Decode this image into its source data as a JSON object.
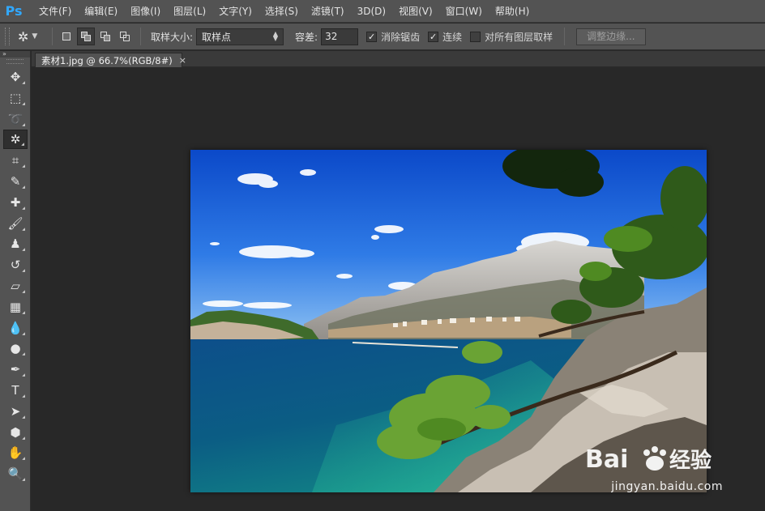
{
  "app": {
    "logo": "Ps",
    "brand_color": "#31a8ff"
  },
  "menu": [
    {
      "label": "文件(F)"
    },
    {
      "label": "编辑(E)"
    },
    {
      "label": "图像(I)"
    },
    {
      "label": "图层(L)"
    },
    {
      "label": "文字(Y)"
    },
    {
      "label": "选择(S)"
    },
    {
      "label": "滤镜(T)"
    },
    {
      "label": "3D(D)"
    },
    {
      "label": "视图(V)"
    },
    {
      "label": "窗口(W)"
    },
    {
      "label": "帮助(H)"
    }
  ],
  "options": {
    "tool_icon": "magic-wand-icon",
    "sample_size_label": "取样大小:",
    "sample_size_value": "取样点",
    "tolerance_label": "容差:",
    "tolerance_value": "32",
    "antialias_label": "消除锯齿",
    "antialias_checked": true,
    "contiguous_label": "连续",
    "contiguous_checked": true,
    "all_layers_label": "对所有图层取样",
    "all_layers_checked": false,
    "refine_edge_label": "调整边缘..."
  },
  "tools": [
    {
      "name": "move-tool",
      "glyph": "✥"
    },
    {
      "name": "marquee-tool",
      "glyph": "⬚"
    },
    {
      "name": "lasso-tool",
      "glyph": "➰"
    },
    {
      "name": "magic-wand-tool",
      "glyph": "✲",
      "active": true
    },
    {
      "name": "crop-tool",
      "glyph": "⌗"
    },
    {
      "name": "eyedropper-tool",
      "glyph": "✎"
    },
    {
      "name": "healing-brush-tool",
      "glyph": "✚"
    },
    {
      "name": "brush-tool",
      "glyph": "🖌"
    },
    {
      "name": "clone-stamp-tool",
      "glyph": "♟"
    },
    {
      "name": "history-brush-tool",
      "glyph": "↺"
    },
    {
      "name": "eraser-tool",
      "glyph": "▱"
    },
    {
      "name": "gradient-tool",
      "glyph": "▦"
    },
    {
      "name": "blur-tool",
      "glyph": "💧"
    },
    {
      "name": "dodge-tool",
      "glyph": "●"
    },
    {
      "name": "pen-tool",
      "glyph": "✒"
    },
    {
      "name": "type-tool",
      "glyph": "T"
    },
    {
      "name": "path-selection-tool",
      "glyph": "➤"
    },
    {
      "name": "shape-tool",
      "glyph": "⬢"
    },
    {
      "name": "hand-tool",
      "glyph": "✋"
    },
    {
      "name": "zoom-tool",
      "glyph": "🔍"
    }
  ],
  "document": {
    "tab_title": "素材1.jpg @ 66.7%(RGB/8#)",
    "close_glyph": "×"
  },
  "watermark": {
    "brand": "Bai",
    "brand_suffix": "经验",
    "url": "jingyan.baidu.com"
  }
}
